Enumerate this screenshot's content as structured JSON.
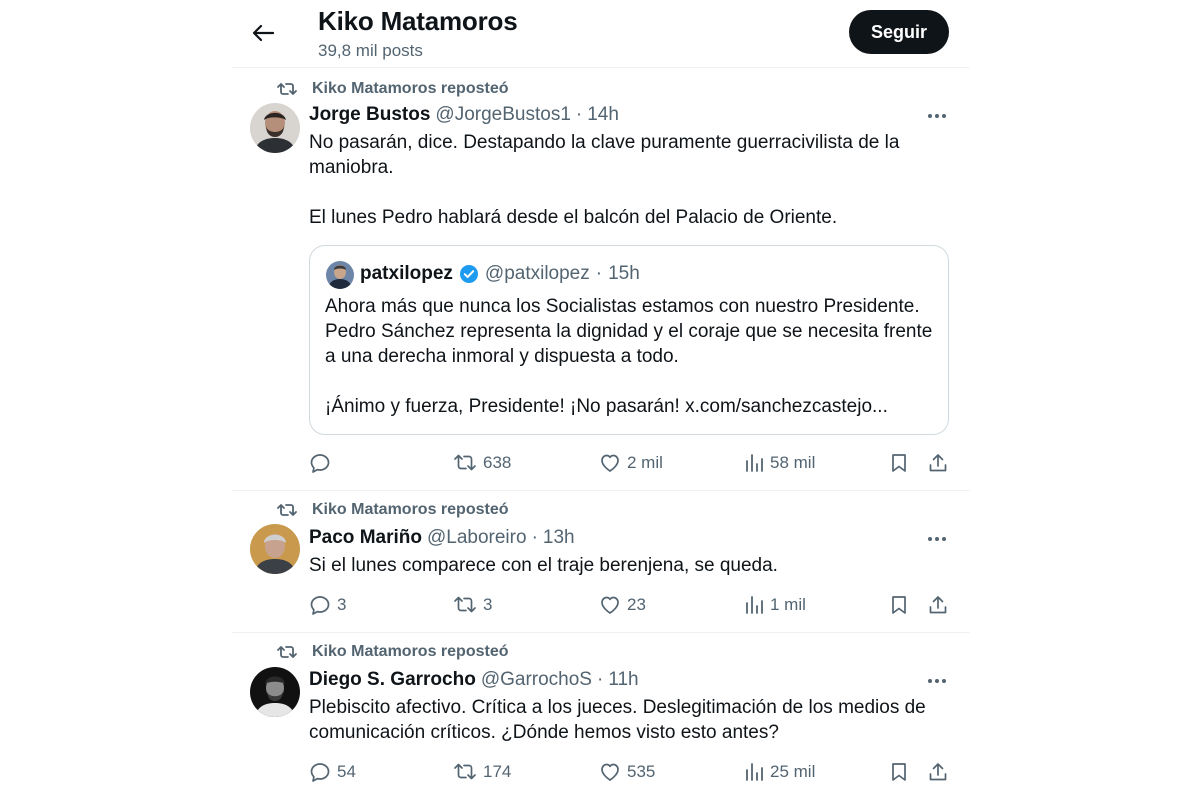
{
  "header": {
    "title": "Kiko Matamoros",
    "subtitle": "39,8 mil posts",
    "follow_label": "Seguir"
  },
  "tweets": [
    {
      "repost_label": "Kiko Matamoros reposteó",
      "name": "Jorge Bustos",
      "handle": "@JorgeBustos1",
      "dot": "·",
      "time": "14h",
      "text": [
        "No pasarán, dice. Destapando la clave puramente guerracivilista de la maniobra.",
        "El lunes Pedro hablará desde el balcón del Palacio de Oriente."
      ],
      "quote": {
        "name": "patxilopez",
        "verified": true,
        "handle": "@patxilopez",
        "dot": "·",
        "time": "15h",
        "text": [
          "Ahora más que nunca los Socialistas estamos con nuestro Presidente. Pedro Sánchez representa la dignidad y el coraje que se necesita frente a una derecha inmoral y dispuesta a todo.",
          "¡Ánimo y fuerza, Presidente! ¡No pasarán! x.com/sanchezcastejo..."
        ]
      },
      "stats": {
        "replies": "",
        "reposts": "638",
        "likes": "2 mil",
        "views": "58 mil"
      }
    },
    {
      "repost_label": "Kiko Matamoros reposteó",
      "name": "Paco Mariño",
      "handle": "@Laboreiro",
      "dot": "·",
      "time": "13h",
      "text": [
        "Si el lunes comparece con el traje berenjena, se queda."
      ],
      "stats": {
        "replies": "3",
        "reposts": "3",
        "likes": "23",
        "views": "1 mil"
      }
    },
    {
      "repost_label": "Kiko Matamoros reposteó",
      "name": "Diego S. Garrocho",
      "handle": "@GarrochoS",
      "dot": "·",
      "time": "11h",
      "text": [
        "Plebiscito afectivo. Crítica a los jueces. Deslegitimación de los medios de comunicación críticos. ¿Dónde hemos visto esto antes?"
      ],
      "stats": {
        "replies": "54",
        "reposts": "174",
        "likes": "535",
        "views": "25 mil"
      }
    }
  ],
  "colors": {
    "text_primary": "#0f1419",
    "text_secondary": "#536471",
    "border": "#eff3f4",
    "verified": "#1d9bf0",
    "follow_bg": "#0f1419"
  },
  "icons": {
    "back": "arrow-left-icon",
    "repost": "repost-icon",
    "more": "more-dots-icon",
    "reply": "reply-icon",
    "like": "heart-icon",
    "views": "views-chart-icon",
    "bookmark": "bookmark-icon",
    "share": "share-icon",
    "verified": "verified-badge-icon"
  }
}
